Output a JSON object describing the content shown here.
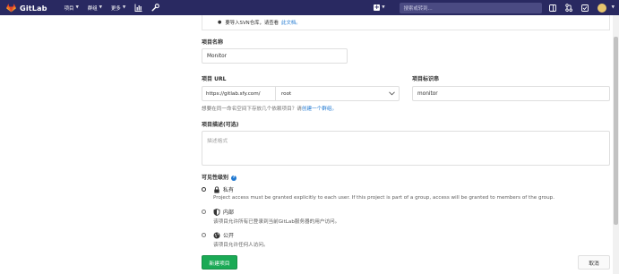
{
  "navbar": {
    "brand": "GitLab",
    "menus": [
      {
        "label": "项目"
      },
      {
        "label": "群组"
      },
      {
        "label": "更多"
      }
    ],
    "search_placeholder": "搜索或转到..."
  },
  "info": {
    "text": "要导入SVN仓库，请查看",
    "link": "此文档。"
  },
  "form": {
    "project_name_label": "项目名称",
    "project_name_value": "Monitor",
    "project_url_label": "项目 URL",
    "url_prefix": "https://gitlab.sfy.com/",
    "namespace_value": "root",
    "slug_label": "项目标识串",
    "slug_value": "monitor",
    "help_text": "想要在同一命名空间下存放几个依赖项目？请",
    "help_link": "创建一个群组。",
    "description_label": "项目描述(可选)",
    "description_placeholder": "描述格式",
    "visibility_label": "可见性级别",
    "visibility_options": [
      {
        "title": "私有",
        "desc": "Project access must be granted explicitly to each user. If this project is part of a group, access will be granted to members of the group.",
        "icon": "lock-icon",
        "selected": true
      },
      {
        "title": "内部",
        "desc": "该项目允许所有已登录到当前GitLab服务器的用户访问。",
        "icon": "shield-icon",
        "selected": false
      },
      {
        "title": "公开",
        "desc": "该项目允许任何人访问。",
        "icon": "globe-icon",
        "selected": false
      }
    ],
    "create_button": "新建项目",
    "cancel_button": "取消"
  },
  "colors": {
    "navbar": "#292961",
    "primary": "#1aaa55",
    "link": "#1f78d1"
  }
}
